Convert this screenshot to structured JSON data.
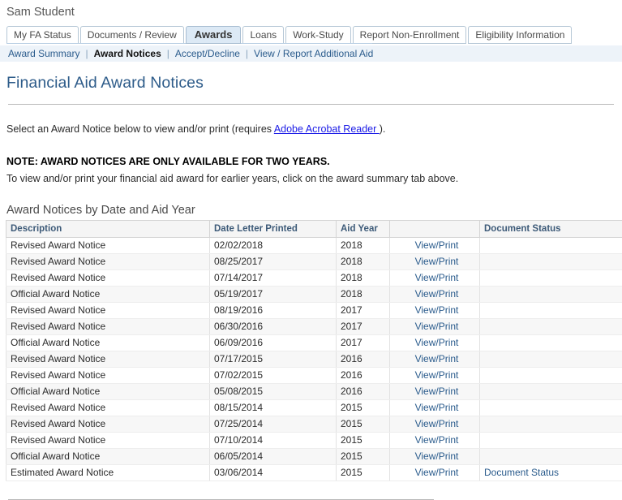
{
  "user": {
    "name": "Sam Student"
  },
  "tabs": [
    {
      "label": "My FA Status",
      "active": false
    },
    {
      "label": "Documents / Review",
      "active": false
    },
    {
      "label": "Awards",
      "active": true
    },
    {
      "label": "Loans",
      "active": false
    },
    {
      "label": "Work-Study",
      "active": false
    },
    {
      "label": "Report Non-Enrollment",
      "active": false
    },
    {
      "label": "Eligibility Information",
      "active": false
    }
  ],
  "subnav": {
    "separator": "|",
    "items": [
      {
        "label": "Award Summary",
        "current": false
      },
      {
        "label": "Award Notices",
        "current": true
      },
      {
        "label": "Accept/Decline",
        "current": false
      },
      {
        "label": "View / Report Additional Aid",
        "current": false
      }
    ]
  },
  "page": {
    "title": "Financial Aid Award Notices",
    "intro_before_link": "Select an Award Notice below to view and/or print (requires ",
    "intro_link": "Adobe Acrobat Reader ",
    "intro_after_link": ").",
    "note_bold": "NOTE: AWARD NOTICES ARE ONLY AVAILABLE FOR TWO YEARS.",
    "note_sub": "To view and/or print your financial aid award for earlier years, click on the award summary tab above."
  },
  "table": {
    "heading": "Award Notices by Date and Aid Year",
    "columns": [
      "Description",
      "Date Letter Printed",
      "Aid Year",
      "",
      "Document Status"
    ],
    "action_label": "View/Print",
    "rows": [
      {
        "description": "Revised Award Notice",
        "date": "02/02/2018",
        "aid_year": "2018",
        "action": "View/Print",
        "status": ""
      },
      {
        "description": "Revised Award Notice",
        "date": "08/25/2017",
        "aid_year": "2018",
        "action": "View/Print",
        "status": ""
      },
      {
        "description": "Revised Award Notice",
        "date": "07/14/2017",
        "aid_year": "2018",
        "action": "View/Print",
        "status": ""
      },
      {
        "description": "Official Award Notice",
        "date": "05/19/2017",
        "aid_year": "2018",
        "action": "View/Print",
        "status": ""
      },
      {
        "description": "Revised Award Notice",
        "date": "08/19/2016",
        "aid_year": "2017",
        "action": "View/Print",
        "status": ""
      },
      {
        "description": "Revised Award Notice",
        "date": "06/30/2016",
        "aid_year": "2017",
        "action": "View/Print",
        "status": ""
      },
      {
        "description": "Official Award Notice",
        "date": "06/09/2016",
        "aid_year": "2017",
        "action": "View/Print",
        "status": ""
      },
      {
        "description": "Revised Award Notice",
        "date": "07/17/2015",
        "aid_year": "2016",
        "action": "View/Print",
        "status": ""
      },
      {
        "description": "Revised Award Notice",
        "date": "07/02/2015",
        "aid_year": "2016",
        "action": "View/Print",
        "status": ""
      },
      {
        "description": "Official Award Notice",
        "date": "05/08/2015",
        "aid_year": "2016",
        "action": "View/Print",
        "status": ""
      },
      {
        "description": "Revised Award Notice",
        "date": "08/15/2014",
        "aid_year": "2015",
        "action": "View/Print",
        "status": ""
      },
      {
        "description": "Revised Award Notice",
        "date": "07/25/2014",
        "aid_year": "2015",
        "action": "View/Print",
        "status": ""
      },
      {
        "description": "Revised Award Notice",
        "date": "07/10/2014",
        "aid_year": "2015",
        "action": "View/Print",
        "status": ""
      },
      {
        "description": "Official Award Notice",
        "date": "06/05/2014",
        "aid_year": "2015",
        "action": "View/Print",
        "status": ""
      },
      {
        "description": "Estimated Award Notice",
        "date": "03/06/2014",
        "aid_year": "2015",
        "action": "View/Print",
        "status": "Document Status"
      }
    ]
  },
  "colors": {
    "accent_blue": "#2a5b8c",
    "title_blue": "#2e5c8a",
    "active_tab_bg": "#dce9f5",
    "subnav_bg": "#edf3f9",
    "header_row_bg": "#f5f5f5",
    "stripe_bg": "#f7f7f7",
    "link_purple_blue": "#1a1ae6"
  }
}
